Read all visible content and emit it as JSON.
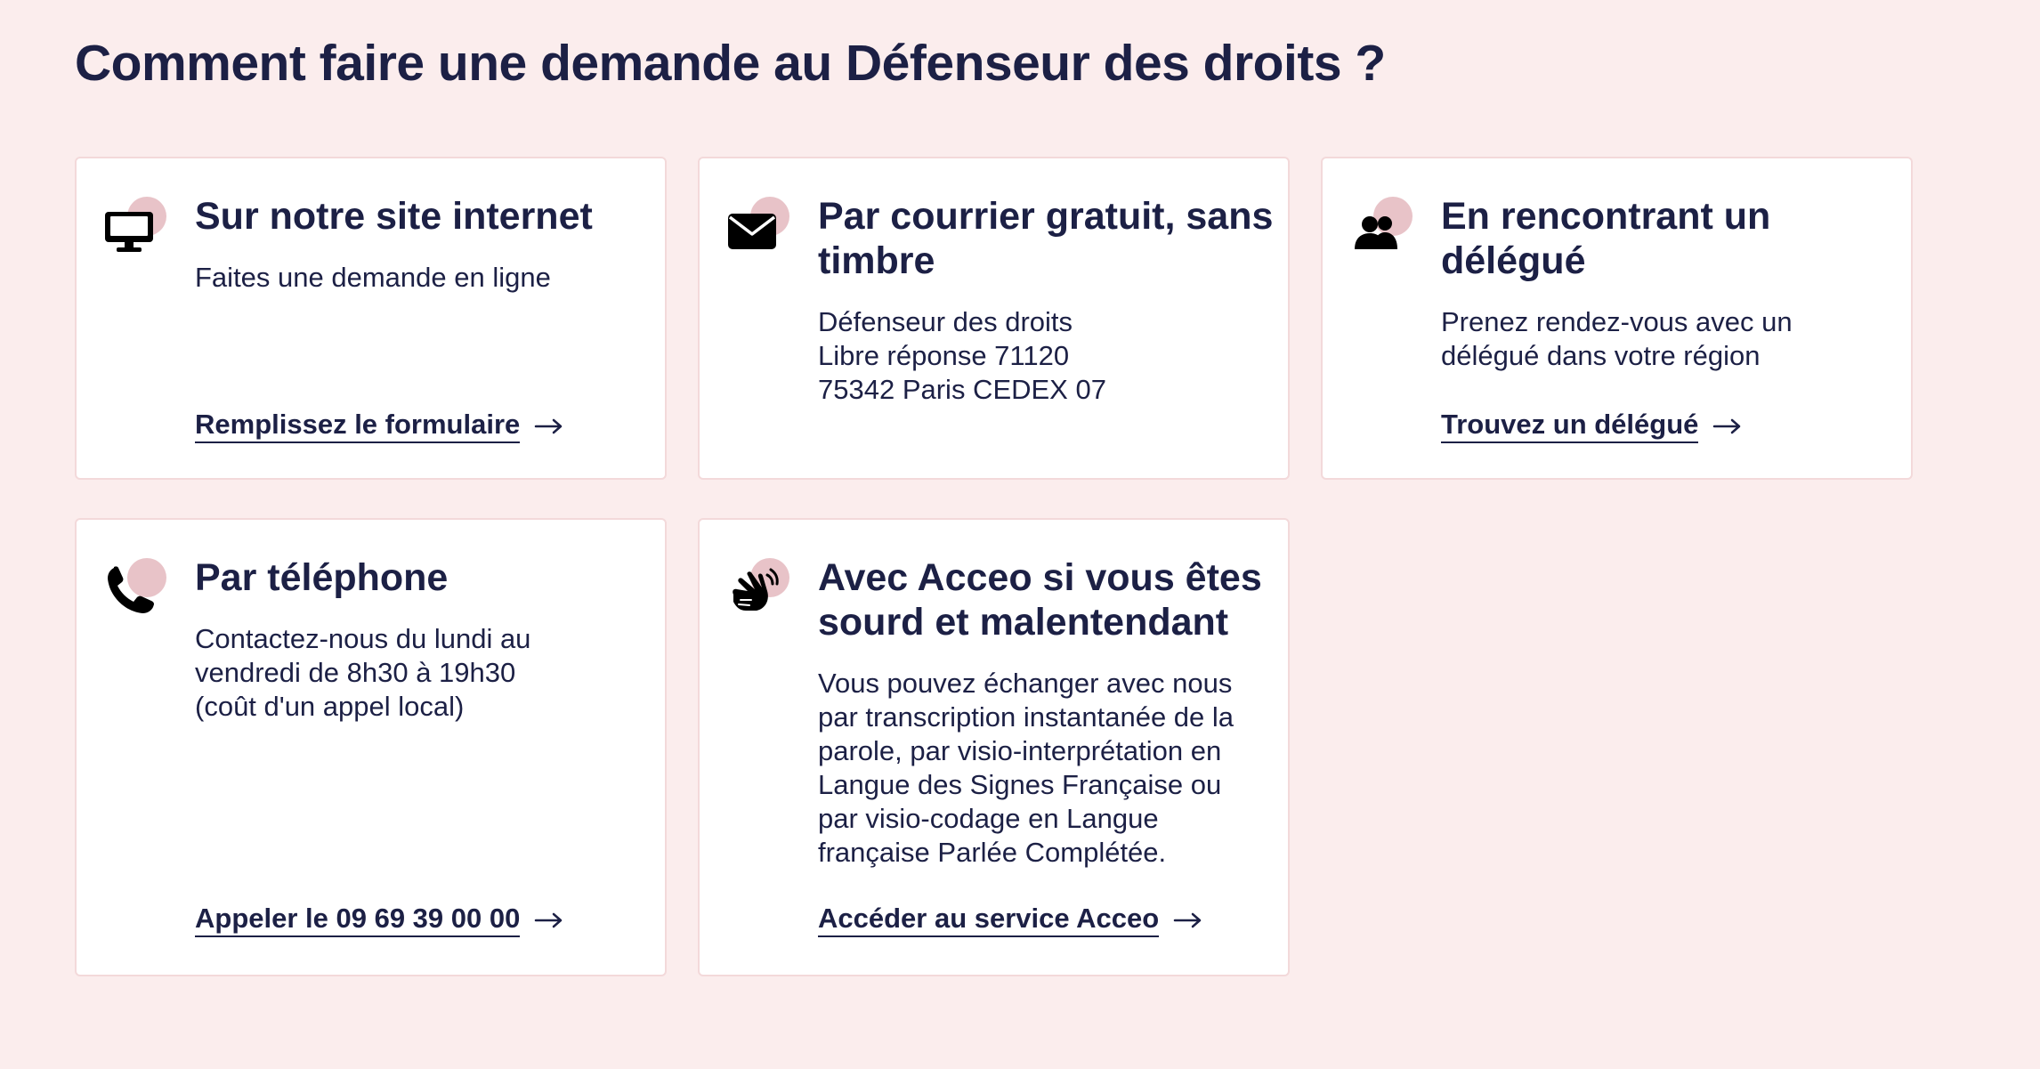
{
  "page": {
    "title": "Comment faire une demande au Défenseur des droits ?"
  },
  "colors": {
    "background": "#fbeded",
    "card_border": "#f3d9da",
    "text": "#1c2045",
    "icon_accent_circle": "#e8c3c8"
  },
  "cards": [
    {
      "icon": "desktop-icon",
      "title": "Sur notre site internet",
      "body_lines": [
        "Faites une demande en ligne"
      ],
      "link": "Remplissez le formulaire"
    },
    {
      "icon": "envelope-icon",
      "title": "Par courrier gratuit, sans timbre",
      "body_lines": [
        "Défenseur des droits",
        "Libre réponse 71120",
        "75342 Paris CEDEX 07"
      ]
    },
    {
      "icon": "users-icon",
      "title": "En rencontrant un délégué",
      "body_lines": [
        "Prenez rendez-vous avec un délégué dans votre région"
      ],
      "link": "Trouvez un délégué"
    },
    {
      "icon": "phone-icon",
      "title": "Par téléphone",
      "body_lines": [
        "Contactez-nous du lundi au vendredi de 8h30 à 19h30 (coût d'un appel local)"
      ],
      "link": "Appeler le 09 69 39 00 00"
    },
    {
      "icon": "sign-language-icon",
      "title": "Avec Acceo si vous êtes sourd et malentendant",
      "body_lines": [
        "Vous pouvez échanger avec nous par transcription instantanée de la parole, par visio-interprétation en Langue des Signes Française ou par visio-codage en Langue française Parlée Complétée."
      ],
      "link": "Accéder au service Acceo"
    }
  ]
}
